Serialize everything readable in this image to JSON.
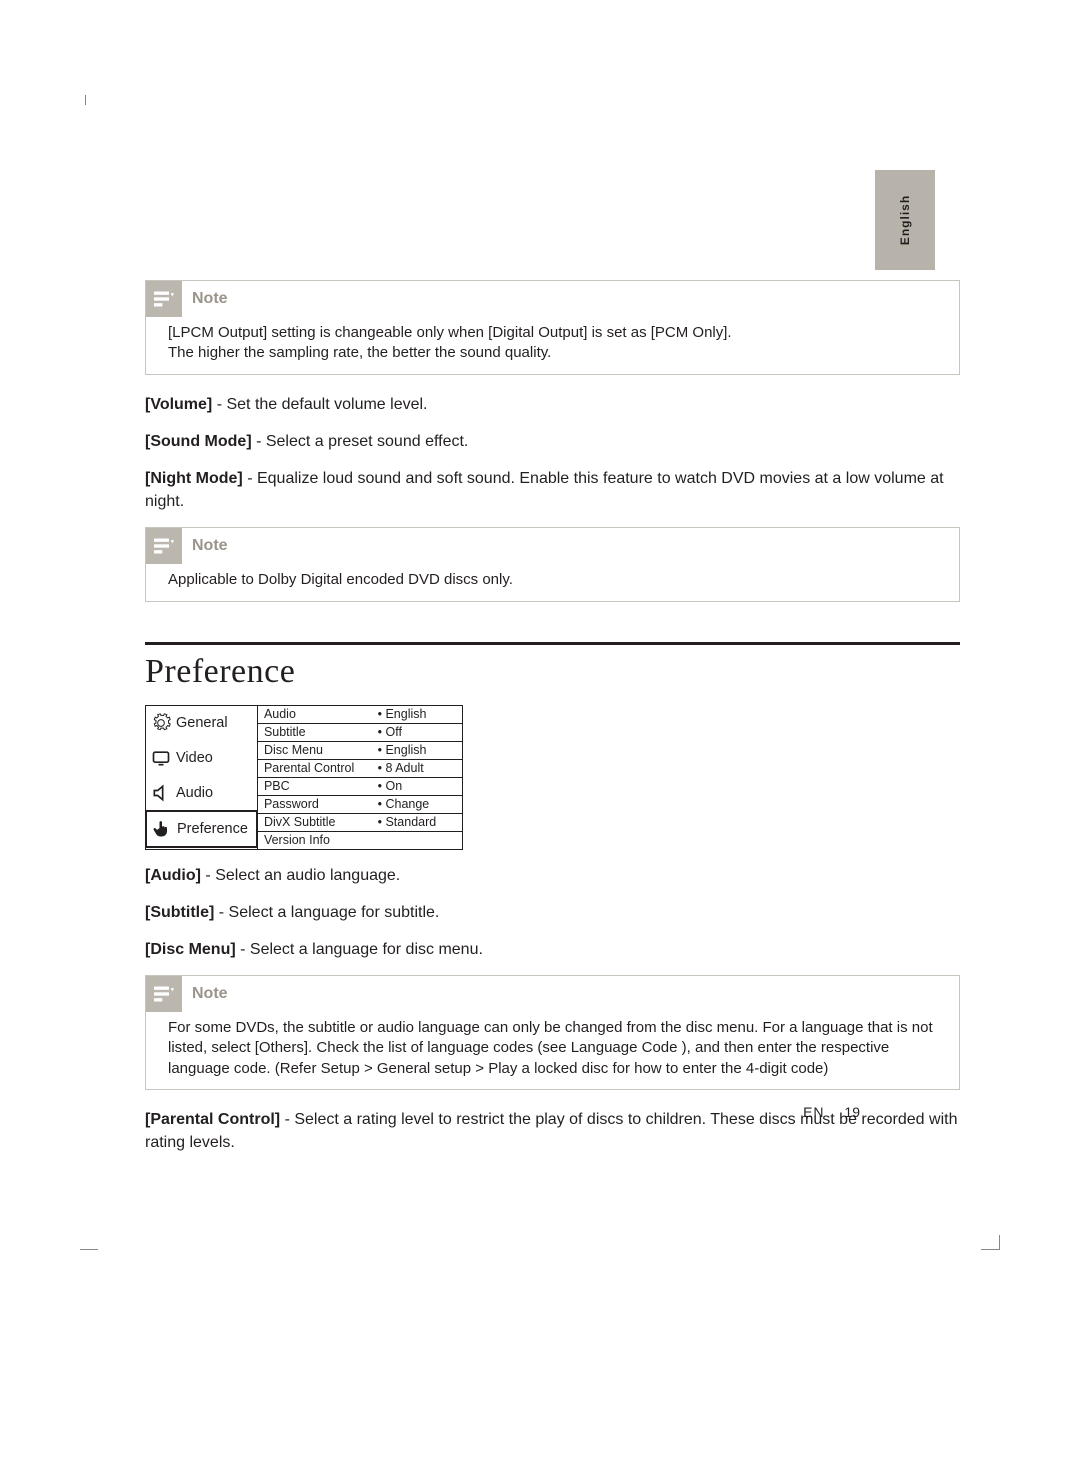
{
  "lang_tab": "English",
  "note_label": "Note",
  "note1_lines": [
    "[LPCM Output] setting is changeable only when [Digital Output] is set as [PCM Only].",
    "The higher the sampling rate, the better the sound quality."
  ],
  "settings": {
    "volume": {
      "label": "[Volume]",
      "desc": " - Set the default volume level."
    },
    "sound_mode": {
      "label": "[Sound Mode]",
      "desc": " - Select a preset sound effect."
    },
    "night_mode": {
      "label": "[Night Mode]",
      "desc": " - Equalize loud sound and soft sound. Enable this feature to watch DVD movies at a low volume at night."
    }
  },
  "note2_line": "Applicable to Dolby Digital encoded DVD discs only.",
  "section_title": "Preference",
  "menu_tabs": {
    "general": "General",
    "video": "Video",
    "audio": "Audio",
    "preference": "Preference"
  },
  "menu_rows": [
    {
      "k": "Audio",
      "v": "• English"
    },
    {
      "k": "Subtitle",
      "v": "•  Off"
    },
    {
      "k": "Disc Menu",
      "v": "• English"
    },
    {
      "k": "Parental Control",
      "v": "• 8 Adult"
    },
    {
      "k": "PBC",
      "v": "• On"
    },
    {
      "k": "Password",
      "v": "• Change"
    },
    {
      "k": "DivX Subtitle",
      "v": "• Standard"
    },
    {
      "k": "Version Info",
      "v": ""
    }
  ],
  "pref_items": {
    "audio": {
      "label": "[Audio]",
      "desc": " - Select an audio language."
    },
    "subtitle": {
      "label": "[Subtitle]",
      "desc": " - Select a language for subtitle."
    },
    "disc_menu": {
      "label": "[Disc Menu]",
      "desc": " - Select a language for disc menu."
    }
  },
  "note3_text": "For some DVDs, the subtitle or audio language can only be changed from the disc menu. For a language that is not listed, select [Others]. Check the list of language codes (see Language Code ), and then enter the respective language code. (Refer Setup  >   General setup  >   Play a locked disc for how to enter the 4-digit code)",
  "parental": {
    "label": "[Parental Control]",
    "desc": " - Select a rating level to restrict the play of discs to children. These discs must be recorded with rating levels."
  },
  "footer": {
    "en": "EN",
    "page": "19"
  }
}
